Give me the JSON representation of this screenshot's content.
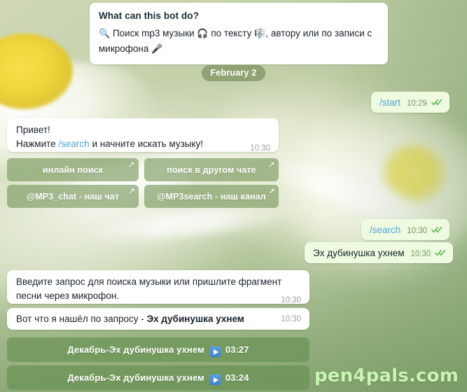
{
  "app": {
    "platform": "telegram-chat",
    "watermark": "pen4pals.com"
  },
  "bot_info_panel": {
    "title": "What can this bot do?",
    "search_icon": "magnifier-emoji",
    "text_part1": "Поиск mp3 музыки",
    "headphones_icon": "headphones-emoji",
    "text_part2": "по тексту",
    "music_score_icon": "musical-score-emoji",
    "text_part3": ", автору или по записи с микрофона",
    "microphone_icon": "microphone-emoji"
  },
  "date_divider": {
    "label": "February 2"
  },
  "messages": [
    {
      "id": "msg-start",
      "direction": "out",
      "text": "/start",
      "is_command": true,
      "time": "10:29",
      "status": "read"
    },
    {
      "id": "msg-greeting",
      "direction": "in",
      "line1": "Привет!",
      "line2_prefix": "Нажмите ",
      "line2_command": "/search",
      "line2_suffix": " и начните искать музыку!",
      "time": "10:30"
    },
    {
      "id": "msg-search-cmd",
      "direction": "out",
      "text": "/search",
      "is_command": true,
      "time": "10:30",
      "status": "read"
    },
    {
      "id": "msg-query",
      "direction": "out",
      "text": "Эх дубинушка ухнем",
      "is_command": false,
      "time": "10:30",
      "status": "read"
    },
    {
      "id": "msg-prompt",
      "direction": "in",
      "text": "Введите запрос для поиска музыки или пришлите фрагмент песни через микрофон.",
      "time": "10:30"
    },
    {
      "id": "msg-found",
      "direction": "in",
      "text_prefix": "Вот что я нашёл по запросу - ",
      "text_bold": "Эх дубинушка ухнем",
      "time": "10:30"
    }
  ],
  "inline_keyboard": [
    {
      "label": "инлайн поиск",
      "icon": "external-link-arrow-icon"
    },
    {
      "label": "поиск в другом чате",
      "icon": "external-link-arrow-icon"
    },
    {
      "label": "@MP3_chat - наш чат",
      "icon": "external-link-arrow-icon"
    },
    {
      "label": "@MP3search - наш канал",
      "icon": "external-link-arrow-icon"
    }
  ],
  "search_results": [
    {
      "title": "Декабрь-Эх дубинушка ухнем",
      "play_icon": "play-button-icon",
      "duration": "03:27"
    },
    {
      "title": "Декабрь-Эх дубинушка ухнем",
      "play_icon": "play-button-icon",
      "duration": "03:24"
    }
  ],
  "colors": {
    "outgoing_bubble": "#effbe0",
    "incoming_bubble": "#ffffff",
    "command_link": "#4ea4e0",
    "tick_green": "#5cbb4e",
    "inline_button": "rgba(118,150,88,0.62)",
    "result_button": "rgba(104,145,82,0.70)",
    "watermark": "#c9f5b4"
  }
}
